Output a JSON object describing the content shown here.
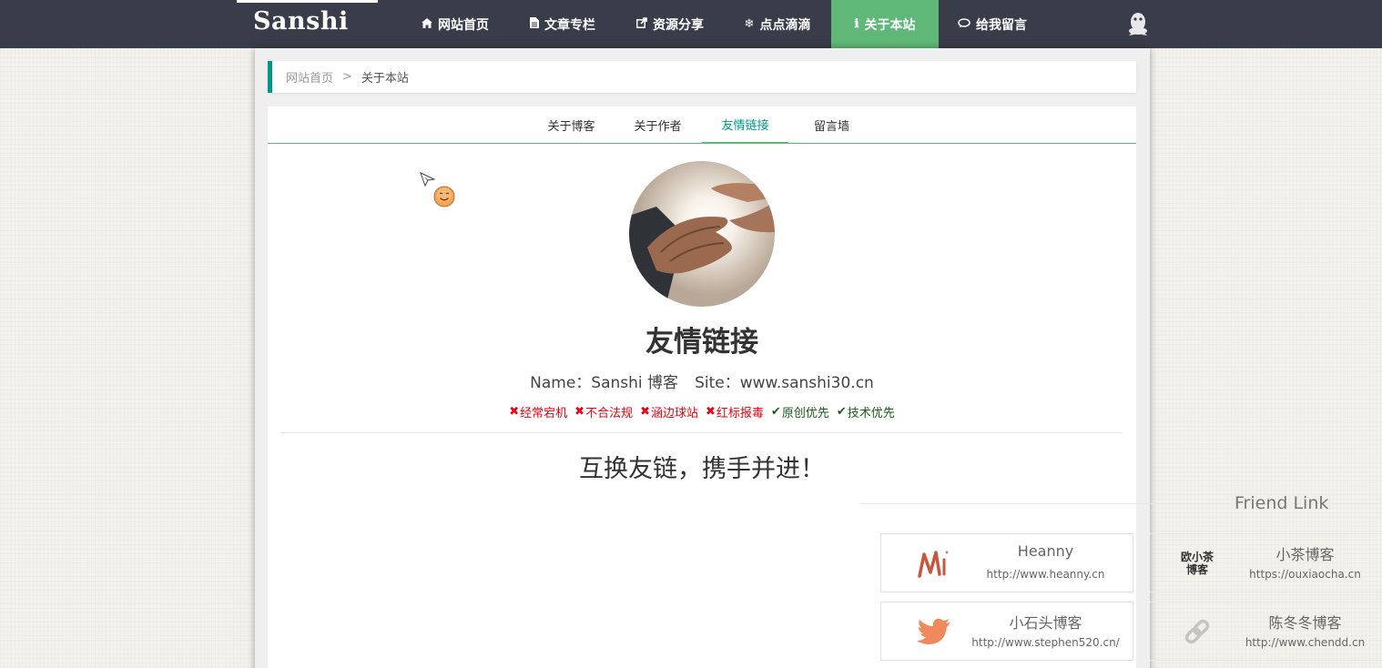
{
  "nav": {
    "logo": "Sanshi",
    "items": [
      {
        "icon": "home-icon",
        "label": "网站首页"
      },
      {
        "icon": "file-icon",
        "label": "文章专栏"
      },
      {
        "icon": "share-icon",
        "label": "资源分享"
      },
      {
        "icon": "snowflake-icon",
        "label": "点点滴滴"
      },
      {
        "icon": "info-icon",
        "label": "关于本站"
      },
      {
        "icon": "comment-icon",
        "label": "给我留言"
      }
    ],
    "active_color": "#5fb878",
    "bar_color": "#393d49"
  },
  "breadcrumb": {
    "home": "网站首页",
    "separator": ">",
    "current": "关于本站"
  },
  "tabs": [
    "关于博客",
    "关于作者",
    "友情链接",
    "留言墙"
  ],
  "profile": {
    "title": "友情链接",
    "name_line": "Name：Sanshi 博客",
    "site_line": "Site：www.sanshi30.cn"
  },
  "rules": [
    {
      "type": "bad",
      "text": "经常宕机"
    },
    {
      "type": "bad",
      "text": "不合法规"
    },
    {
      "type": "bad",
      "text": "涵边球站"
    },
    {
      "type": "bad",
      "text": "红标报毒"
    },
    {
      "type": "good",
      "text": "原创优先"
    },
    {
      "type": "good",
      "text": "技术优先"
    }
  ],
  "slogan": "互换友链，携手并进！",
  "friend_links": {
    "title": "Friend Link",
    "items": [
      {
        "name": "Heanny",
        "url": "http://www.heanny.cn",
        "logo": "heanny-logo"
      },
      {
        "name": "小茶博客",
        "url": "https://ouxiaocha.cn",
        "logo": "xiaocha-seal",
        "logo_text": "欧小茶博客"
      },
      {
        "name": "小石头博客",
        "url": "http://www.stephen520.cn/",
        "logo": "bird-icon"
      },
      {
        "name": "陈冬冬博客",
        "url": "http://www.chendd.cn",
        "logo": "chain-link-icon"
      }
    ]
  }
}
